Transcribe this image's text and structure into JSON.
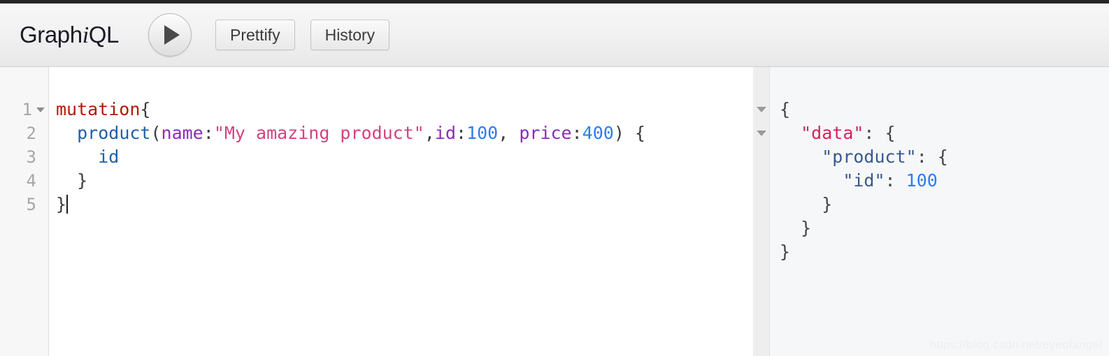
{
  "window": {
    "brand_text_1": "Graph",
    "brand_text_i": "i",
    "brand_text_2": "QL"
  },
  "toolbar": {
    "execute_icon": "play-triangle-icon",
    "execute_label": "",
    "prettify_label": "Prettify",
    "history_label": "History"
  },
  "editor": {
    "line_numbers": [
      "1",
      "2",
      "3",
      "4",
      "5"
    ],
    "fold_arrow_icon": "chevron-down-icon",
    "raw_query": "mutation{\n  product(name:\"My amazing product\",id:100, price:400) {\n    id\n  }\n}",
    "lines": [
      {
        "number": "1",
        "has_fold": true,
        "tokens": [
          {
            "type": "keyword",
            "text": "mutation"
          },
          {
            "type": "punct",
            "text": "{"
          }
        ]
      },
      {
        "number": "2",
        "has_fold": false,
        "tokens": [
          {
            "type": "punct",
            "text": "  "
          },
          {
            "type": "field",
            "text": "product"
          },
          {
            "type": "punct",
            "text": "("
          },
          {
            "type": "argname",
            "text": "name"
          },
          {
            "type": "punct",
            "text": ":"
          },
          {
            "type": "string",
            "text": "\"My amazing product\""
          },
          {
            "type": "punct",
            "text": ","
          },
          {
            "type": "argname",
            "text": "id"
          },
          {
            "type": "punct",
            "text": ":"
          },
          {
            "type": "number",
            "text": "100"
          },
          {
            "type": "punct",
            "text": ", "
          },
          {
            "type": "argname",
            "text": "price"
          },
          {
            "type": "punct",
            "text": ":"
          },
          {
            "type": "number",
            "text": "400"
          },
          {
            "type": "punct",
            "text": ") {"
          }
        ]
      },
      {
        "number": "3",
        "has_fold": false,
        "tokens": [
          {
            "type": "punct",
            "text": "    "
          },
          {
            "type": "field",
            "text": "id"
          }
        ]
      },
      {
        "number": "4",
        "has_fold": false,
        "tokens": [
          {
            "type": "punct",
            "text": "  }"
          }
        ]
      },
      {
        "number": "5",
        "has_fold": false,
        "has_caret": true,
        "tokens": [
          {
            "type": "punct",
            "text": "}"
          }
        ]
      }
    ]
  },
  "result": {
    "fold_arrow_icon": "chevron-down-icon",
    "fold_arrow_count": 2,
    "raw_json": "{\n  \"data\": {\n    \"product\": {\n      \"id\": 100\n    }\n  }\n}",
    "lines": [
      {
        "tokens": [
          {
            "type": "brace",
            "text": "{"
          }
        ]
      },
      {
        "tokens": [
          {
            "type": "brace",
            "text": "  "
          },
          {
            "type": "key-data",
            "text": "\"data\""
          },
          {
            "type": "brace",
            "text": ": {"
          }
        ]
      },
      {
        "tokens": [
          {
            "type": "brace",
            "text": "    "
          },
          {
            "type": "key",
            "text": "\"product\""
          },
          {
            "type": "brace",
            "text": ": {"
          }
        ]
      },
      {
        "tokens": [
          {
            "type": "brace",
            "text": "      "
          },
          {
            "type": "key",
            "text": "\"id\""
          },
          {
            "type": "brace",
            "text": ": "
          },
          {
            "type": "number",
            "text": "100"
          }
        ]
      },
      {
        "tokens": [
          {
            "type": "brace",
            "text": "    }"
          }
        ]
      },
      {
        "tokens": [
          {
            "type": "brace",
            "text": "  }"
          }
        ]
      },
      {
        "tokens": [
          {
            "type": "brace",
            "text": "}"
          }
        ]
      }
    ]
  },
  "watermark": {
    "text": "https://blog.csdn.net/eyeofangel"
  },
  "colors": {
    "keyword": "#b11a04",
    "field": "#1f61a9",
    "argname": "#8b2bb9",
    "string": "#d6417f",
    "number": "#2f7ced",
    "result_key_data": "#d2245a",
    "result_key": "#37598f",
    "toolbar_bg": "#f2f2f2",
    "result_bg": "#f6f7f9",
    "gutter_bg": "#f7f7f7"
  }
}
